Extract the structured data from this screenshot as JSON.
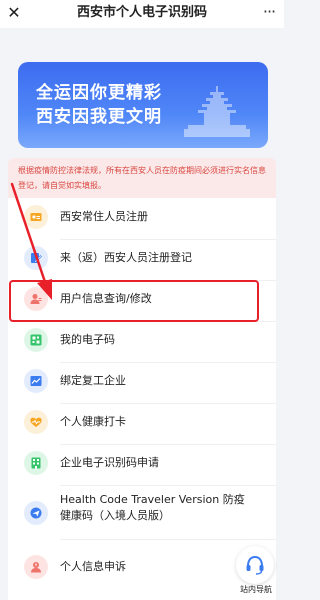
{
  "navbar": {
    "close_icon": "✕",
    "title": "西安市个人电子识别码",
    "more_icon": "···"
  },
  "banner": {
    "line1": "全运因你更精彩",
    "line2": "西安因我更文明"
  },
  "notice": {
    "text": "根据疫情防控法律法规，所有在西安人员在防疫期间必须进行实名信息登记，请自觉如实填报。"
  },
  "menu": {
    "items": [
      {
        "label": "西安常住人员注册",
        "icon": "id-card-icon",
        "color": "#f6a623"
      },
      {
        "label": "来（返）西安人员注册登记",
        "icon": "edit-icon",
        "color": "#3b7df0"
      },
      {
        "label": "用户信息查询/修改",
        "icon": "user-icon",
        "color": "#f0736b"
      },
      {
        "label": "我的电子码",
        "icon": "qr-code-icon",
        "color": "#34c46a"
      },
      {
        "label": "绑定复工企业",
        "icon": "chart-icon",
        "color": "#3b7df0"
      },
      {
        "label": "个人健康打卡",
        "icon": "heart-icon",
        "color": "#f6a623"
      },
      {
        "label": "企业电子识别码申请",
        "icon": "building-icon",
        "color": "#34c46a"
      },
      {
        "label": "Health Code Traveler Version 防疫健康码（入境人员版）",
        "icon": "plane-icon",
        "color": "#3b7df0"
      },
      {
        "label": "个人信息申诉",
        "icon": "appeal-icon",
        "color": "#f0736b"
      }
    ]
  },
  "fab": {
    "label": "站内导航",
    "icon": "headset-icon"
  },
  "annotation": {
    "highlight_color": "#e8202a"
  }
}
